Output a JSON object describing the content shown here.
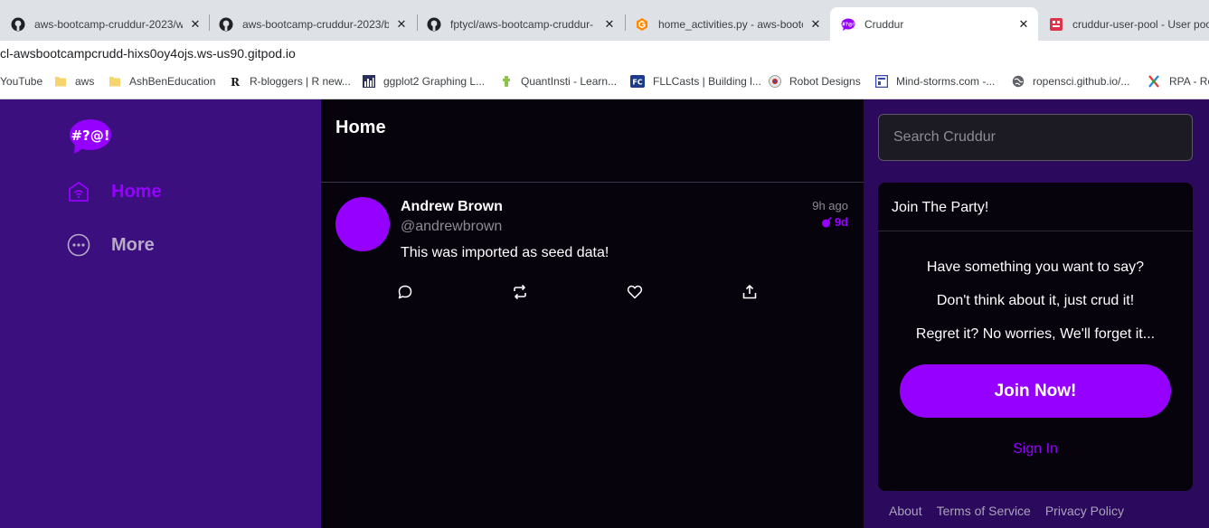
{
  "browser": {
    "tabs": [
      {
        "title": "aws-bootcamp-cruddur-2023/w",
        "icon": "github-icon"
      },
      {
        "title": "aws-bootcamp-cruddur-2023/b",
        "icon": "github-icon"
      },
      {
        "title": "fptycl/aws-bootcamp-cruddur-",
        "icon": "github-icon"
      },
      {
        "title": "home_activities.py - aws-bootc",
        "icon": "gitpod-icon"
      },
      {
        "title": "Cruddur",
        "icon": "cruddur-icon"
      },
      {
        "title": "cruddur-user-pool - User poo",
        "icon": "aws-icon"
      }
    ],
    "close_glyph": "✕",
    "address": "cl-awsbootcampcrudd-hixs0oy4ojs.ws-us90.gitpod.io",
    "bookmarks": [
      {
        "label": "YouTube",
        "icon": "youtube-icon"
      },
      {
        "label": "aws",
        "icon": "folder-icon"
      },
      {
        "label": "AshBenEducation",
        "icon": "folder-icon"
      },
      {
        "label": "R-bloggers | R new...",
        "icon": "rbloggers-icon"
      },
      {
        "label": "ggplot2 Graphing L...",
        "icon": "chart-icon"
      },
      {
        "label": "QuantInsti - Learn...",
        "icon": "quantinsti-icon"
      },
      {
        "label": "FLLCasts | Building l...",
        "icon": "fllcasts-icon"
      },
      {
        "label": "Robot Designs",
        "icon": "robot-icon"
      },
      {
        "label": "Mind-storms.com -...",
        "icon": "mindstorms-icon"
      },
      {
        "label": "ropensci.github.io/...",
        "icon": "globe-icon"
      },
      {
        "label": "RPA - Ro",
        "icon": "rpa-icon"
      }
    ]
  },
  "sidebar": {
    "logo_text": "#?@!",
    "items": [
      {
        "label": "Home",
        "icon": "home-icon",
        "active": true
      },
      {
        "label": "More",
        "icon": "more-icon",
        "active": false
      }
    ]
  },
  "feed": {
    "title": "Home",
    "activities": [
      {
        "display_name": "Andrew Brown",
        "handle": "@andrewbrown",
        "message": "This was imported as seed data!",
        "created": "9h ago",
        "expires": "9d",
        "actions": [
          "reply-icon",
          "repost-icon",
          "like-icon",
          "share-icon"
        ]
      }
    ]
  },
  "right": {
    "search_placeholder": "Search Cruddur",
    "join": {
      "title": "Join The Party!",
      "lines": [
        "Have something you want to say?",
        "Don't think about it, just crud it!",
        "Regret it? No worries, We'll forget it..."
      ],
      "button": "Join Now!",
      "signin": "Sign In"
    },
    "footer": [
      "About",
      "Terms of Service",
      "Privacy Policy"
    ]
  },
  "colors": {
    "accent": "#9500ff",
    "sidebar_bg": "#3c0f7e",
    "feed_bg": "#07030d",
    "right_bg": "#2b0a5e"
  }
}
